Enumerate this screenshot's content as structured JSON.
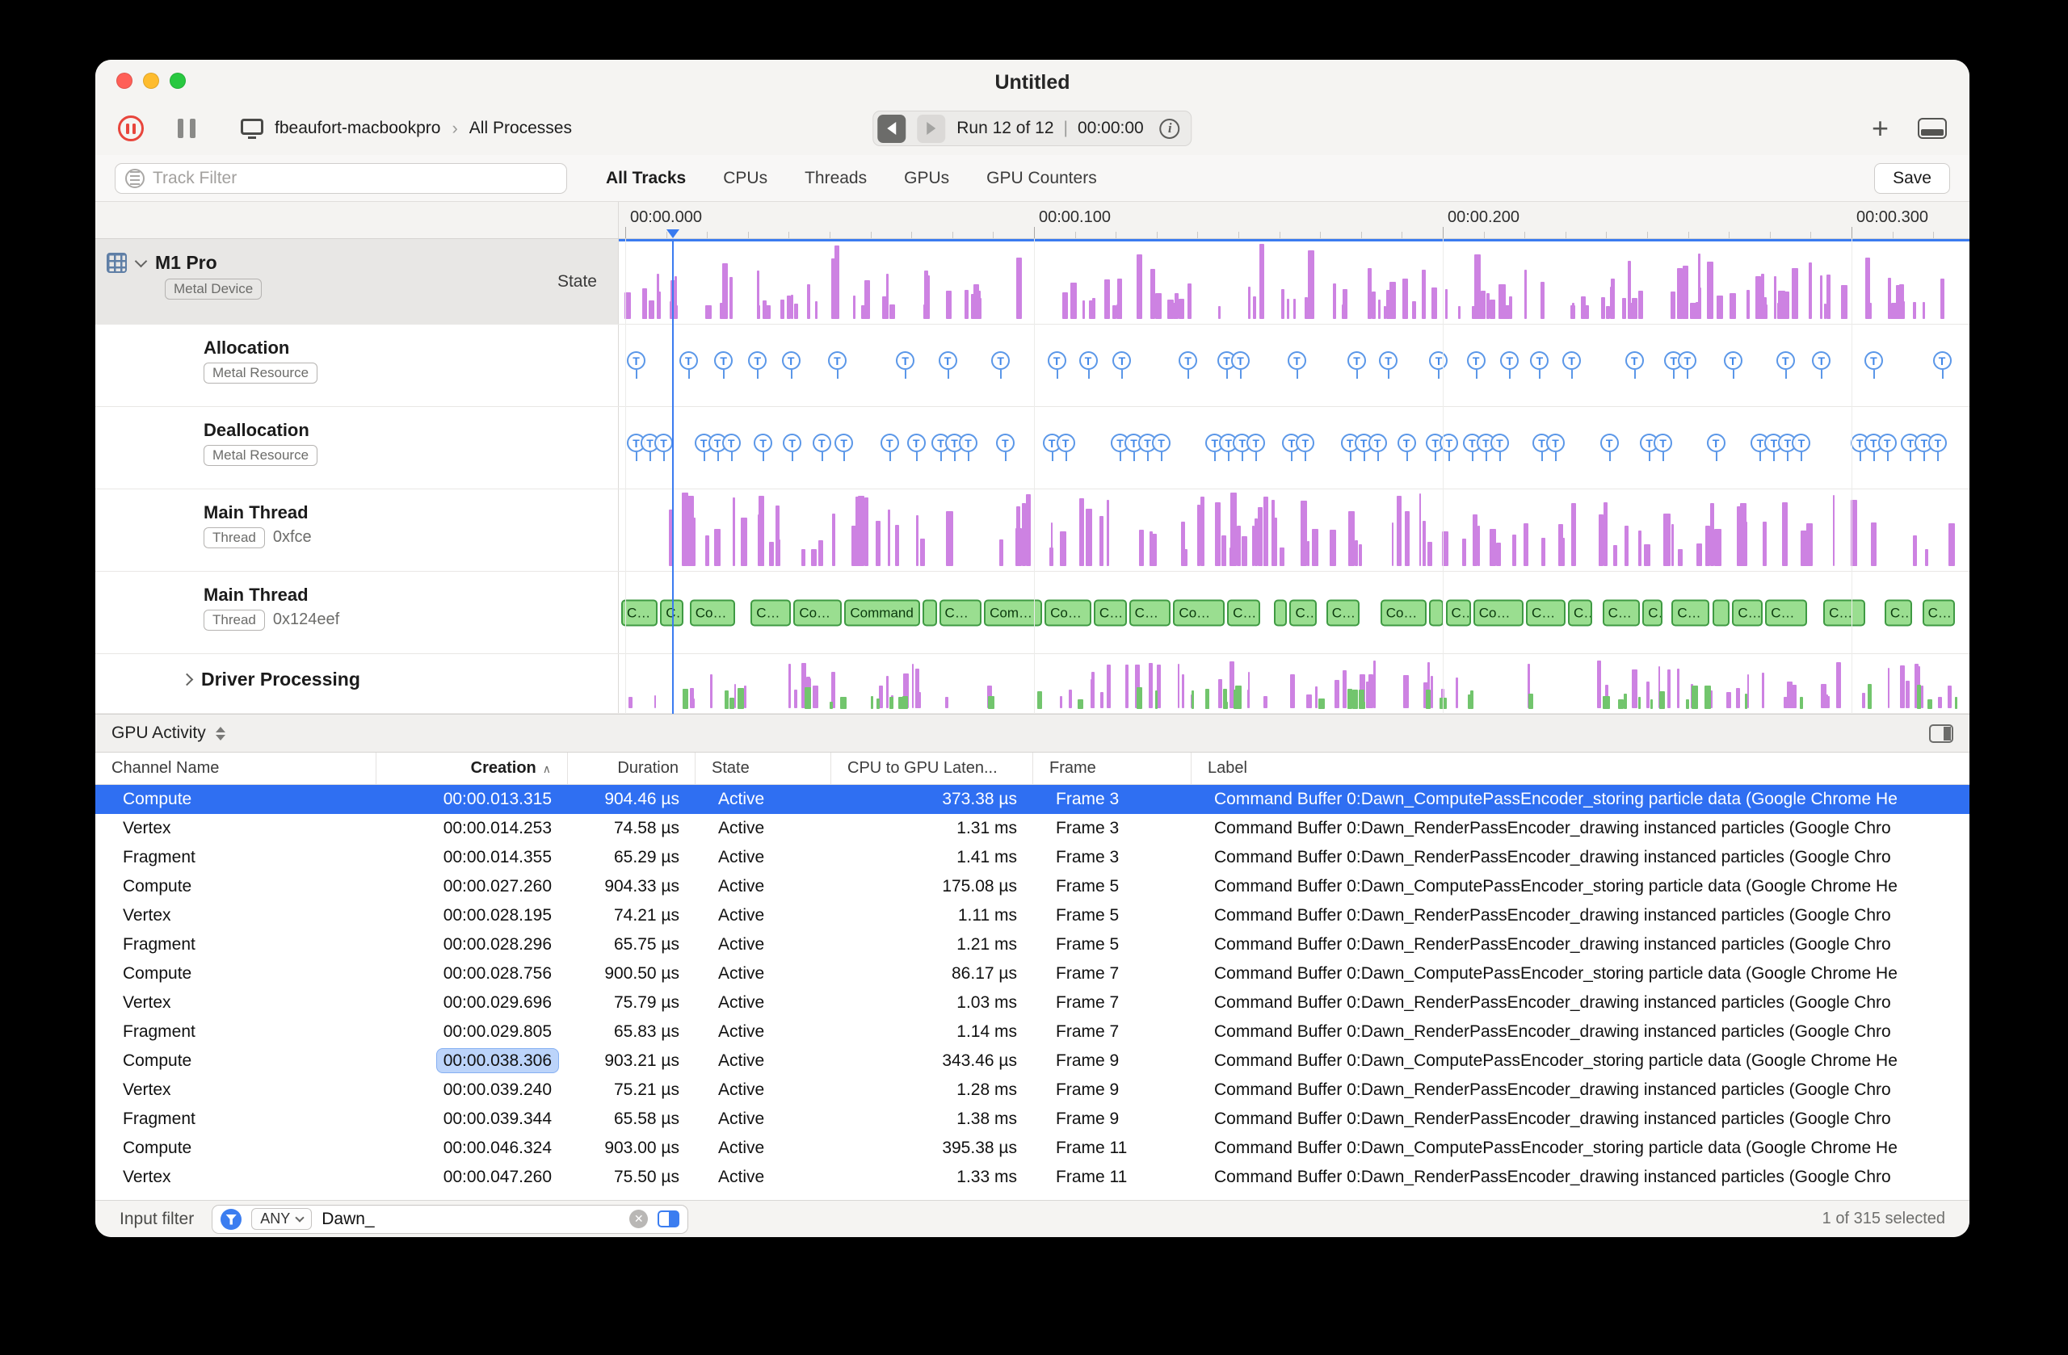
{
  "colors": {
    "accent_blue": "#3a7bf0",
    "state_purple": "#cd82e2",
    "command_green_fill": "#9ade90",
    "command_green_border": "#3f9a43",
    "flag_blue": "#5b97e8",
    "selection_blue": "#2f6ff2"
  },
  "window": {
    "title": "Untitled"
  },
  "toolbar": {
    "host": "fbeaufort-macbookpro",
    "separator": "›",
    "scope": "All Processes",
    "run_label": "Run 12 of 12",
    "run_divider": "|",
    "run_time": "00:00:00",
    "info_glyph": "i",
    "add_glyph": "+"
  },
  "filterbar": {
    "placeholder": "Track Filter",
    "tabs": [
      {
        "label": "All Tracks",
        "selected": true
      },
      {
        "label": "CPUs",
        "selected": false
      },
      {
        "label": "Threads",
        "selected": false
      },
      {
        "label": "GPUs",
        "selected": false
      },
      {
        "label": "GPU Counters",
        "selected": false
      }
    ],
    "save": "Save"
  },
  "ruler": {
    "labels": [
      "00:00.000",
      "00:00.100",
      "00:00.200",
      "00:00.300"
    ]
  },
  "timeline": {
    "flag_glyph": "T",
    "span_label": "Command"
  },
  "tracks": [
    {
      "name": "M1 Pro",
      "tag": "Metal Device",
      "right_label": "State",
      "kind": "state",
      "device": true,
      "expanded": true
    },
    {
      "name": "Allocation",
      "tag": "Metal Resource",
      "kind": "flags"
    },
    {
      "name": "Deallocation",
      "tag": "Metal Resource",
      "kind": "flags-dense"
    },
    {
      "name": "Main Thread",
      "tag": "Thread",
      "detail": "0xfce",
      "kind": "bars"
    },
    {
      "name": "Main Thread",
      "tag": "Thread",
      "detail": "0x124eef",
      "kind": "spans"
    },
    {
      "name": "Driver Processing",
      "kind": "mixed",
      "collapsed": true
    }
  ],
  "activity": {
    "selector": "GPU Activity"
  },
  "table": {
    "columns": [
      {
        "label": "Channel Name",
        "align": "left"
      },
      {
        "label": "Creation",
        "align": "right",
        "sorted": "asc"
      },
      {
        "label": "Duration",
        "align": "right"
      },
      {
        "label": "State",
        "align": "left"
      },
      {
        "label": "CPU to GPU Laten...",
        "align": "left"
      },
      {
        "label": "Frame",
        "align": "left"
      },
      {
        "label": "Label",
        "align": "left"
      }
    ],
    "rows": [
      {
        "channel": "Compute",
        "creation": "00:00.013.315",
        "duration": "904.46 µs",
        "state": "Active",
        "latency": "373.38 µs",
        "frame": "Frame 3",
        "label": "Command Buffer 0:Dawn_ComputePassEncoder_storing particle data   (Google Chrome He",
        "selected": true,
        "highlight": false
      },
      {
        "channel": "Vertex",
        "creation": "00:00.014.253",
        "duration": "74.58 µs",
        "state": "Active",
        "latency": "1.31 ms",
        "frame": "Frame 3",
        "label": "Command Buffer 0:Dawn_RenderPassEncoder_drawing instanced particles   (Google Chro",
        "selected": false,
        "highlight": false
      },
      {
        "channel": "Fragment",
        "creation": "00:00.014.355",
        "duration": "65.29 µs",
        "state": "Active",
        "latency": "1.41 ms",
        "frame": "Frame 3",
        "label": "Command Buffer 0:Dawn_RenderPassEncoder_drawing instanced particles   (Google Chro",
        "selected": false,
        "highlight": false
      },
      {
        "channel": "Compute",
        "creation": "00:00.027.260",
        "duration": "904.33 µs",
        "state": "Active",
        "latency": "175.08 µs",
        "frame": "Frame 5",
        "label": "Command Buffer 0:Dawn_ComputePassEncoder_storing particle data   (Google Chrome He",
        "selected": false,
        "highlight": false
      },
      {
        "channel": "Vertex",
        "creation": "00:00.028.195",
        "duration": "74.21 µs",
        "state": "Active",
        "latency": "1.11 ms",
        "frame": "Frame 5",
        "label": "Command Buffer 0:Dawn_RenderPassEncoder_drawing instanced particles   (Google Chro",
        "selected": false,
        "highlight": false
      },
      {
        "channel": "Fragment",
        "creation": "00:00.028.296",
        "duration": "65.75 µs",
        "state": "Active",
        "latency": "1.21 ms",
        "frame": "Frame 5",
        "label": "Command Buffer 0:Dawn_RenderPassEncoder_drawing instanced particles   (Google Chro",
        "selected": false,
        "highlight": false
      },
      {
        "channel": "Compute",
        "creation": "00:00.028.756",
        "duration": "900.50 µs",
        "state": "Active",
        "latency": "86.17 µs",
        "frame": "Frame 7",
        "label": "Command Buffer 0:Dawn_ComputePassEncoder_storing particle data   (Google Chrome He",
        "selected": false,
        "highlight": false
      },
      {
        "channel": "Vertex",
        "creation": "00:00.029.696",
        "duration": "75.79 µs",
        "state": "Active",
        "latency": "1.03 ms",
        "frame": "Frame 7",
        "label": "Command Buffer 0:Dawn_RenderPassEncoder_drawing instanced particles   (Google Chro",
        "selected": false,
        "highlight": false
      },
      {
        "channel": "Fragment",
        "creation": "00:00.029.805",
        "duration": "65.83 µs",
        "state": "Active",
        "latency": "1.14 ms",
        "frame": "Frame 7",
        "label": "Command Buffer 0:Dawn_RenderPassEncoder_drawing instanced particles   (Google Chro",
        "selected": false,
        "highlight": false
      },
      {
        "channel": "Compute",
        "creation": "00:00.038.306",
        "duration": "903.21 µs",
        "state": "Active",
        "latency": "343.46 µs",
        "frame": "Frame 9",
        "label": "Command Buffer 0:Dawn_ComputePassEncoder_storing particle data   (Google Chrome He",
        "selected": false,
        "highlight": true
      },
      {
        "channel": "Vertex",
        "creation": "00:00.039.240",
        "duration": "75.21 µs",
        "state": "Active",
        "latency": "1.28 ms",
        "frame": "Frame 9",
        "label": "Command Buffer 0:Dawn_RenderPassEncoder_drawing instanced particles   (Google Chro",
        "selected": false,
        "highlight": false
      },
      {
        "channel": "Fragment",
        "creation": "00:00.039.344",
        "duration": "65.58 µs",
        "state": "Active",
        "latency": "1.38 ms",
        "frame": "Frame 9",
        "label": "Command Buffer 0:Dawn_RenderPassEncoder_drawing instanced particles   (Google Chro",
        "selected": false,
        "highlight": false
      },
      {
        "channel": "Compute",
        "creation": "00:00.046.324",
        "duration": "903.00 µs",
        "state": "Active",
        "latency": "395.38 µs",
        "frame": "Frame 11",
        "label": "Command Buffer 0:Dawn_ComputePassEncoder_storing particle data   (Google Chrome He",
        "selected": false,
        "highlight": false
      },
      {
        "channel": "Vertex",
        "creation": "00:00.047.260",
        "duration": "75.50 µs",
        "state": "Active",
        "latency": "1.33 ms",
        "frame": "Frame 11",
        "label": "Command Buffer 0:Dawn_RenderPassEncoder_drawing instanced particles   (Google Chro",
        "selected": false,
        "highlight": false
      }
    ]
  },
  "statusbar": {
    "input_filter_label": "Input filter",
    "match_mode": "ANY",
    "filter_value": "Dawn_",
    "clear_glyph": "✕",
    "selection": "1 of 315 selected"
  }
}
